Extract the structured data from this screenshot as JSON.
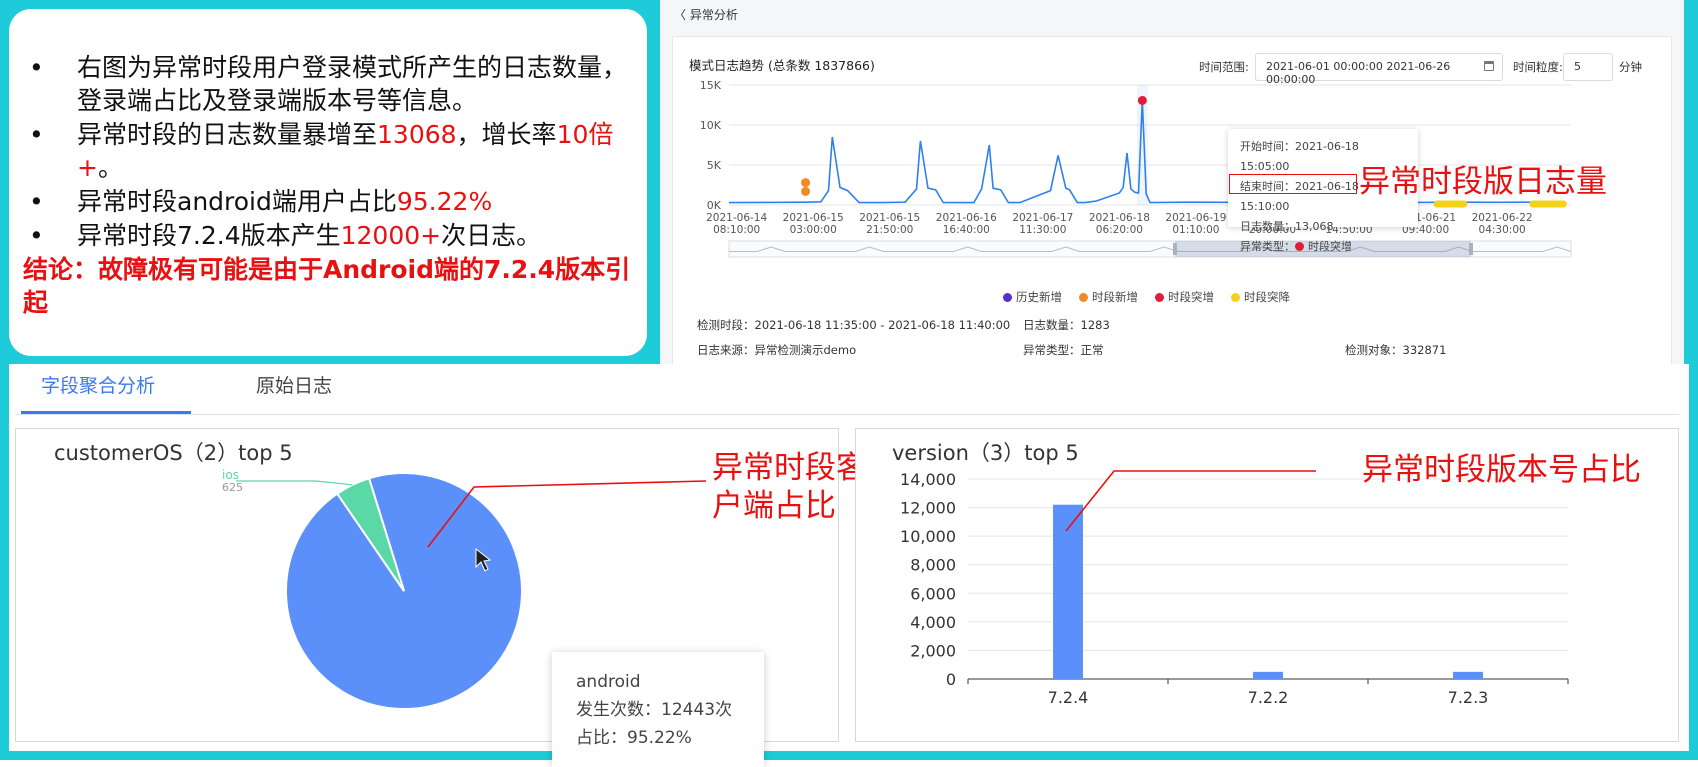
{
  "left_summary": {
    "bullets": [
      {
        "t1": "右图为异常时段用户登录模式所产生的日志数量，登录端占比及登录端版本号等信息。",
        "red": "",
        "t2": ""
      },
      {
        "t1": "异常时段的日志数量暴增至",
        "red": "13068",
        "t2": "，增长率",
        "red2": "10倍+",
        "t3": "。"
      },
      {
        "t1": "异常时段android端用户占比",
        "red": "95.22%",
        "t2": ""
      },
      {
        "t1": "异常时段7.2.4版本产生",
        "red": "12000+",
        "t2": "次日志。"
      }
    ],
    "conclusion": "结论：故障极有可能是由于Android端的7.2.4版本引起"
  },
  "trend_panel": {
    "back_link": "〈 异常分析",
    "title": "模式日志趋势 (总条数 1837866)",
    "time_range_label": "时间范围:",
    "time_range_value": "2021-06-01 00:00:00 2021-06-26 00:00:00",
    "granularity_label": "时间粒度:",
    "granularity_value": "5",
    "granularity_unit": "分钟",
    "legend": [
      {
        "label": "历史新增",
        "color": "#5a2fcf"
      },
      {
        "label": "时段新增",
        "color": "#f08a24"
      },
      {
        "label": "时段突增",
        "color": "#e01e3c"
      },
      {
        "label": "时段突降",
        "color": "#f5d21a"
      }
    ],
    "tooltip": {
      "start": "开始时间：2021-06-18 15:05:00",
      "end": "结束时间：2021-06-18 15:10:00",
      "count": "日志数量：13,068",
      "type": "异常类型：",
      "type_value": "时段突增"
    },
    "meta": {
      "detect_period": "检测时段：2021-06-18 11:35:00 - 2021-06-18 11:40:00",
      "log_count": "日志数量：1283",
      "source": "日志来源：异常检测演示demo",
      "anomaly_type": "异常类型：正常",
      "detect_object": "检测对象：332871"
    },
    "annotation": "异常时段版日志量"
  },
  "tabs": {
    "active": "字段聚合分析",
    "other": "原始日志"
  },
  "pie_card": {
    "title": "customerOS（2）top 5",
    "annotation_line1": "异常时段客",
    "annotation_line2": "户端占比",
    "tooltip": {
      "name": "android",
      "count": "发生次数：12443次",
      "ratio": "占比：95.22%"
    }
  },
  "bar_card": {
    "title": "version（3）top 5",
    "annotation": "异常时段版本号占比"
  },
  "chart_data": [
    {
      "type": "line",
      "title": "模式日志趋势 (总条数 1837866)",
      "x_ticks": [
        "2021-06-14 08:10:00",
        "2021-06-15 03:00:00",
        "2021-06-15 21:50:00",
        "2021-06-16 16:40:00",
        "2021-06-17 11:30:00",
        "2021-06-18 06:20:00",
        "2021-06-19 01:10:00",
        "2021-06-19 20:00:00",
        "2021-06-20 14:50:00",
        "2021-06-21 09:40:00",
        "2021-06-22 04:30:00"
      ],
      "x_tick_lines": [
        [
          "2021-06-14",
          "08:10:00"
        ],
        [
          "2021-06-15",
          "03:00:00"
        ],
        [
          "2021-06-15",
          "21:50:00"
        ],
        [
          "2021-06-16",
          "16:40:00"
        ],
        [
          "2021-06-17",
          "11:30:00"
        ],
        [
          "2021-06-18",
          "06:20:00"
        ],
        [
          "2021-06-19",
          "01:10:00"
        ],
        [
          "2021-06-19",
          "20:00:00"
        ],
        [
          "2021-06-20",
          "14:50:00"
        ],
        [
          "2021-06-21",
          "09:40:00"
        ],
        [
          "2021-06-22",
          "04:30:00"
        ]
      ],
      "y_ticks": [
        "0K",
        "5K",
        "10K",
        "15K"
      ],
      "ylim": [
        0,
        15000
      ],
      "x": [
        0,
        0.5,
        1,
        1.2,
        1.3,
        1.35,
        1.45,
        1.55,
        1.7,
        2,
        2.3,
        2.45,
        2.5,
        2.6,
        2.7,
        2.8,
        3.2,
        3.3,
        3.4,
        3.45,
        3.55,
        3.65,
        3.8,
        4.2,
        4.3,
        4.4,
        4.45,
        4.55,
        4.65,
        4.8,
        5.1,
        5.15,
        5.2,
        5.25,
        5.3,
        5.35,
        5.4,
        5.45,
        5.5,
        6,
        7,
        7.3,
        7.6,
        8,
        8.3,
        8.6,
        9,
        9.5,
        10,
        10.5
      ],
      "y": [
        300,
        320,
        350,
        400,
        1800,
        8500,
        2200,
        1800,
        300,
        300,
        350,
        2000,
        8000,
        2100,
        1900,
        300,
        300,
        2000,
        7500,
        2100,
        1900,
        300,
        300,
        1800,
        6200,
        2100,
        1900,
        300,
        300,
        500,
        1500,
        2200,
        6500,
        2000,
        1600,
        1500,
        13068,
        1400,
        300,
        350,
        330,
        420,
        380,
        350,
        340,
        360,
        330,
        350,
        340,
        350
      ],
      "markers": [
        {
          "x": 1.0,
          "y": 2800,
          "color": "#f08a24"
        },
        {
          "x": 1.0,
          "y": 1700,
          "color": "#f08a24"
        },
        {
          "x": 5.4,
          "y": 13068,
          "color": "#e01e3c"
        }
      ],
      "drops": [
        {
          "from": 9.25,
          "to": 9.6,
          "color": "#f5d21a"
        },
        {
          "from": 10.5,
          "to": 10.9,
          "color": "#f5d21a"
        }
      ]
    },
    {
      "type": "pie",
      "title": "customerOS（2）top 5",
      "slices": [
        {
          "label": "android",
          "value": 12443,
          "color": "#5b8ff9"
        },
        {
          "label": "ios",
          "value": 625,
          "color": "#5ad8a6"
        }
      ]
    },
    {
      "type": "bar",
      "title": "version（3）top 5",
      "categories": [
        "7.2.4",
        "7.2.2",
        "7.2.3"
      ],
      "values": [
        12200,
        500,
        500
      ],
      "ylim": [
        0,
        14000
      ],
      "y_ticks": [
        "0",
        "2,000",
        "4,000",
        "6,000",
        "8,000",
        "10,000",
        "12,000",
        "14,000"
      ],
      "color": "#5b8ff9"
    }
  ],
  "colors": {
    "frame": "#1dcbd9",
    "accent": "#3a7af0",
    "annotation": "#e81010",
    "line": "#2f80ed"
  }
}
